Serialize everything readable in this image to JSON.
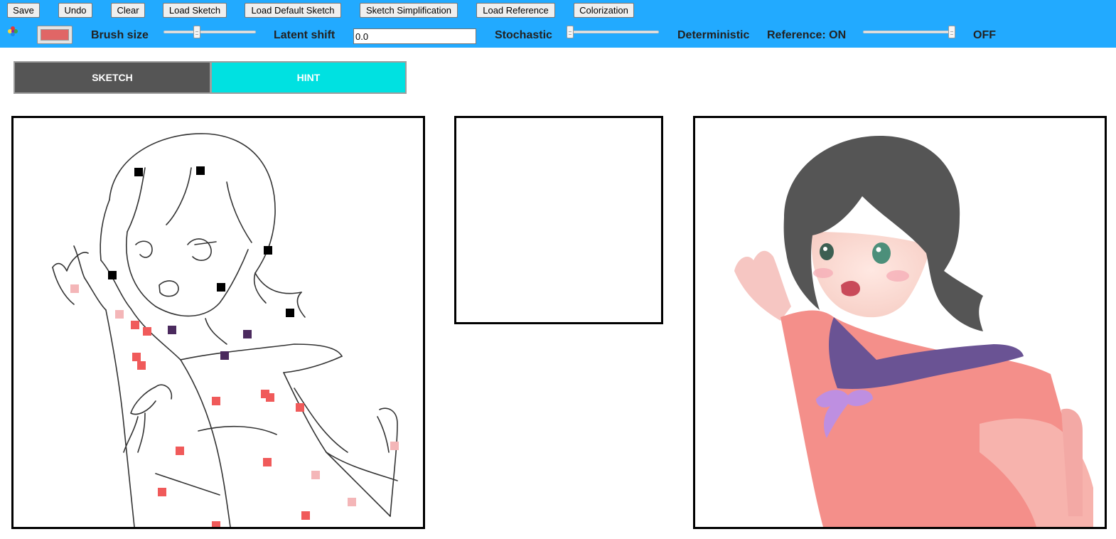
{
  "toolbar": {
    "buttons": {
      "save": "Save",
      "undo": "Undo",
      "clear": "Clear",
      "load_sketch": "Load Sketch",
      "load_default_sketch": "Load Default Sketch",
      "sketch_simplification": "Sketch Simplification",
      "load_reference": "Load Reference",
      "colorization": "Colorization"
    },
    "brush_color": "#e06666",
    "brush_size_label": "Brush size",
    "brush_size_level": 0.35,
    "latent_shift_label": "Latent shift",
    "latent_shift_value": "0.0",
    "stochastic_label": "Stochastic",
    "stochastic_level": 0.0,
    "deterministic_label": "Deterministic",
    "reference_on_label": "Reference: ON",
    "reference_level": 1.0,
    "reference_off_label": "OFF",
    "accent_color": "#22aaff"
  },
  "tabs": {
    "sketch": "SKETCH",
    "hint": "HINT",
    "hint_color": "#00e1e1",
    "sketch_color": "#555555"
  },
  "hint_palette": [
    "#000000",
    "#4b2a5e",
    "#f05a5a",
    "#f4b6b8"
  ]
}
